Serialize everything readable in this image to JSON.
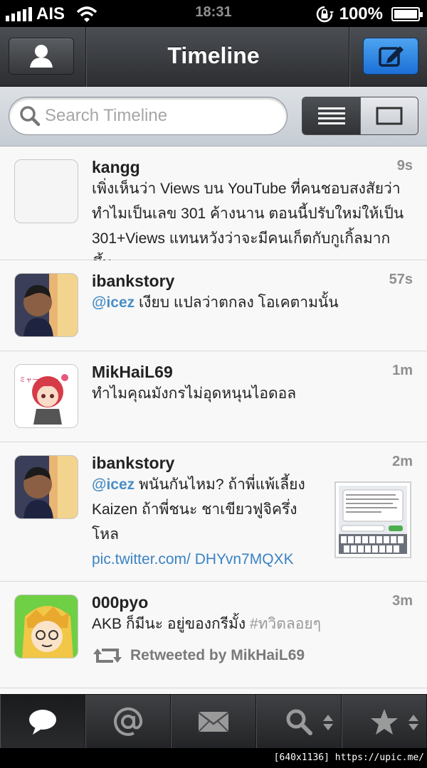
{
  "status_bar": {
    "carrier": "AIS",
    "time": "18:31",
    "battery": "100%"
  },
  "nav": {
    "title": "Timeline"
  },
  "search": {
    "placeholder": "Search Timeline"
  },
  "tweets": [
    {
      "name": "kangg",
      "time": "9s",
      "text": "เพิ่งเห็นว่า Views บน YouTube ที่คนชอบสงสัยว่าทำไมเป็นเลข 301 ค้างนาน ตอนนี้ปรับใหม่ให้เป็น 301+Views แทนหวังว่าจะมีคนเก็ตกับกูเกิ้ลมากขึ้น"
    },
    {
      "name": "ibankstory",
      "time": "57s",
      "mention": "@icez",
      "text": " เงียบ แปลว่าตกลง โอเคตามนั้น"
    },
    {
      "name": "MikHaiL69",
      "time": "1m",
      "text": "ทำไมคุณมังกรไม่อุดหนุนไอดอล"
    },
    {
      "name": "ibankstory",
      "time": "2m",
      "mention": "@icez",
      "text": " พนันกันไหม? ถ้าพี่แพ้เลี้ยง Kaizen ถ้าพี่ชนะ ชาเขียวฟูจิครึ่งโหล",
      "link": "pic.twitter.com/ DHYvn7MQXK"
    },
    {
      "name": "000pyo",
      "time": "3m",
      "text": "AKB ก็มีนะ อยู่ของกรีมั้ง ",
      "hashtag": "#ทวิตลอยๆ",
      "retweet": "Retweeted by MikHaiL69"
    }
  ],
  "footer": {
    "text": "[640x1136] https://upic.me/"
  },
  "colors": {
    "accent": "#1c6fd6",
    "mention": "#4a8ec5",
    "link": "#3b83c4"
  }
}
